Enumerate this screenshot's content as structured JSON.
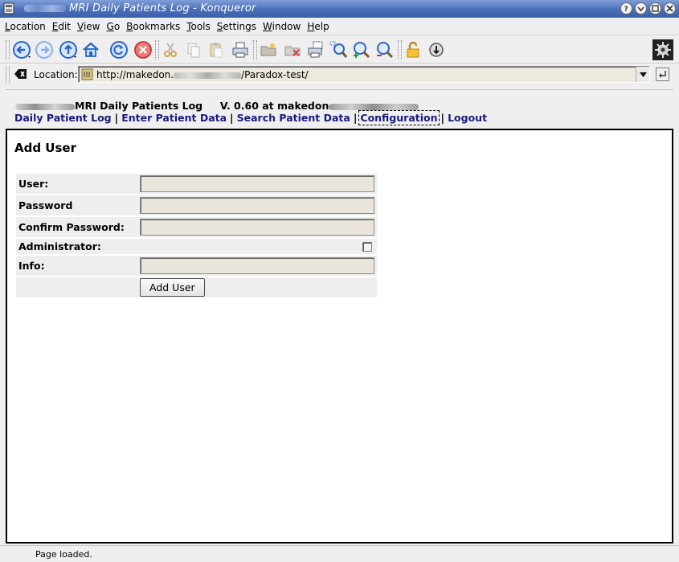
{
  "window": {
    "title": "MRI Daily Patients Log - Konqueror",
    "buttons": [
      "help-icon",
      "shade-icon",
      "maximize-icon",
      "close-icon"
    ]
  },
  "menu": {
    "items": [
      {
        "label": "Location",
        "accel": "L"
      },
      {
        "label": "Edit",
        "accel": "E"
      },
      {
        "label": "View",
        "accel": "V"
      },
      {
        "label": "Go",
        "accel": "G"
      },
      {
        "label": "Bookmarks",
        "accel": "B"
      },
      {
        "label": "Tools",
        "accel": "T"
      },
      {
        "label": "Settings",
        "accel": "S"
      },
      {
        "label": "Window",
        "accel": "W"
      },
      {
        "label": "Help",
        "accel": "H"
      }
    ]
  },
  "toolbar": {
    "buttons": [
      "back-icon",
      "forward-icon",
      "up-icon",
      "home-icon",
      "reload-icon",
      "stop-icon",
      "cut-icon",
      "copy-icon",
      "paste-icon",
      "print-icon",
      "new-folder-icon",
      "delete-icon",
      "print-frame-icon",
      "zoom-icon",
      "zoom-in-icon",
      "zoom-out-icon",
      "security-lock-icon",
      "download-icon",
      "konqueror-gear-icon"
    ]
  },
  "location": {
    "label": "Location:",
    "url_prefix": "http://makedon.",
    "url_suffix": "/Paradox-test/"
  },
  "site": {
    "title": "MRI Daily Patients Log",
    "version": "V. 0.60 at makedon",
    "nav": [
      {
        "label": "Daily Patient Log"
      },
      {
        "label": "Enter Patient Data"
      },
      {
        "label": "Search Patient Data"
      },
      {
        "label": "Configuration"
      },
      {
        "label": "Logout"
      }
    ]
  },
  "form": {
    "heading": "Add User",
    "fields": [
      {
        "label": "User:",
        "value": ""
      },
      {
        "label": "Password",
        "value": ""
      },
      {
        "label": "Confirm Password:",
        "value": ""
      },
      {
        "label": "Administrator:",
        "checked": false
      },
      {
        "label": "Info:",
        "value": ""
      }
    ],
    "submit_label": "Add User"
  },
  "status": {
    "text": "Page loaded."
  },
  "colors": {
    "titlebar": "#4a6fb8",
    "link": "#1a1a80",
    "input_bg": "#e9e5da"
  }
}
